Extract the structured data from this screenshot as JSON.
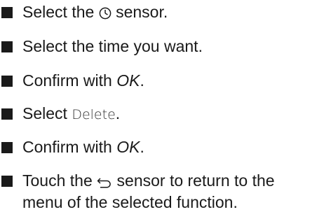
{
  "steps": [
    {
      "before": "Select the",
      "icon": "clock-icon",
      "after": "sensor."
    },
    {
      "text": "Select the time you want."
    },
    {
      "before": "Confirm with",
      "emphasis": "OK",
      "after": "."
    },
    {
      "before": "Select",
      "ui_label": "Delete",
      "after": "."
    },
    {
      "before": "Confirm with",
      "emphasis": "OK",
      "after": "."
    },
    {
      "before": "Touch the",
      "icon": "back-arrow-icon",
      "after": "sensor to return to the",
      "line2": "menu of the selected function."
    }
  ],
  "colors": {
    "text": "#1a1a1a",
    "bullet": "#1a1a1a"
  }
}
